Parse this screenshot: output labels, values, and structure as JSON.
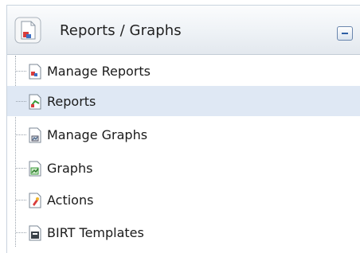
{
  "panel": {
    "title": "Reports / Graphs",
    "header_icon": "reports-graphs-icon",
    "collapse_icon": "collapse-minus-icon"
  },
  "tree": {
    "items": [
      {
        "label": "Manage Reports",
        "icon": "manage-reports-icon",
        "selected": false
      },
      {
        "label": "Reports",
        "icon": "reports-icon",
        "selected": true
      },
      {
        "label": "Manage Graphs",
        "icon": "manage-graphs-icon",
        "selected": false
      },
      {
        "label": "Graphs",
        "icon": "graphs-icon",
        "selected": false
      },
      {
        "label": "Actions",
        "icon": "actions-icon",
        "selected": false
      },
      {
        "label": "BIRT Templates",
        "icon": "birt-templates-icon",
        "selected": false
      }
    ]
  },
  "colors": {
    "selected_row": "#dfe8f4",
    "header_gradient_end": "#e3e8ee",
    "collapse_button_blue": "#2c5ea5"
  }
}
